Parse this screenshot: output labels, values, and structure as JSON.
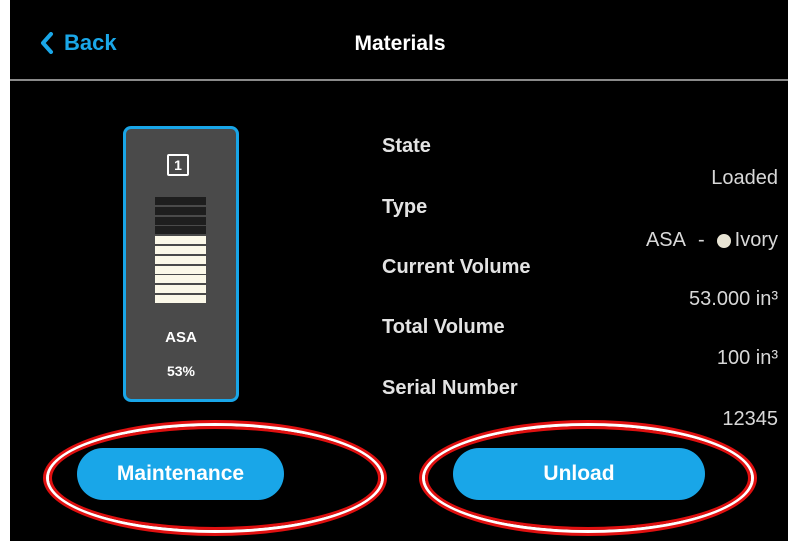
{
  "header": {
    "back_label": "Back",
    "title": "Materials"
  },
  "card": {
    "slot_number": "1",
    "material_type": "ASA",
    "fill_percent_label": "53%",
    "fill_fraction": 0.53,
    "segments_total": 11,
    "accent_color": "#19a6e8"
  },
  "details": {
    "state_label": "State",
    "state_value": "Loaded",
    "type_label": "Type",
    "type_material": "ASA",
    "type_separator": "-",
    "type_color_name": "Ivory",
    "type_color_hex": "#e8e4d4",
    "current_volume_label": "Current Volume",
    "current_volume_value": "53.000 in³",
    "total_volume_label": "Total Volume",
    "total_volume_value": "100 in³",
    "serial_label": "Serial Number",
    "serial_value": "12345"
  },
  "buttons": {
    "maintenance_label": "Maintenance",
    "unload_label": "Unload"
  },
  "icons": {
    "back": "chevron-left-icon",
    "color_swatch": "color-dot-icon"
  }
}
